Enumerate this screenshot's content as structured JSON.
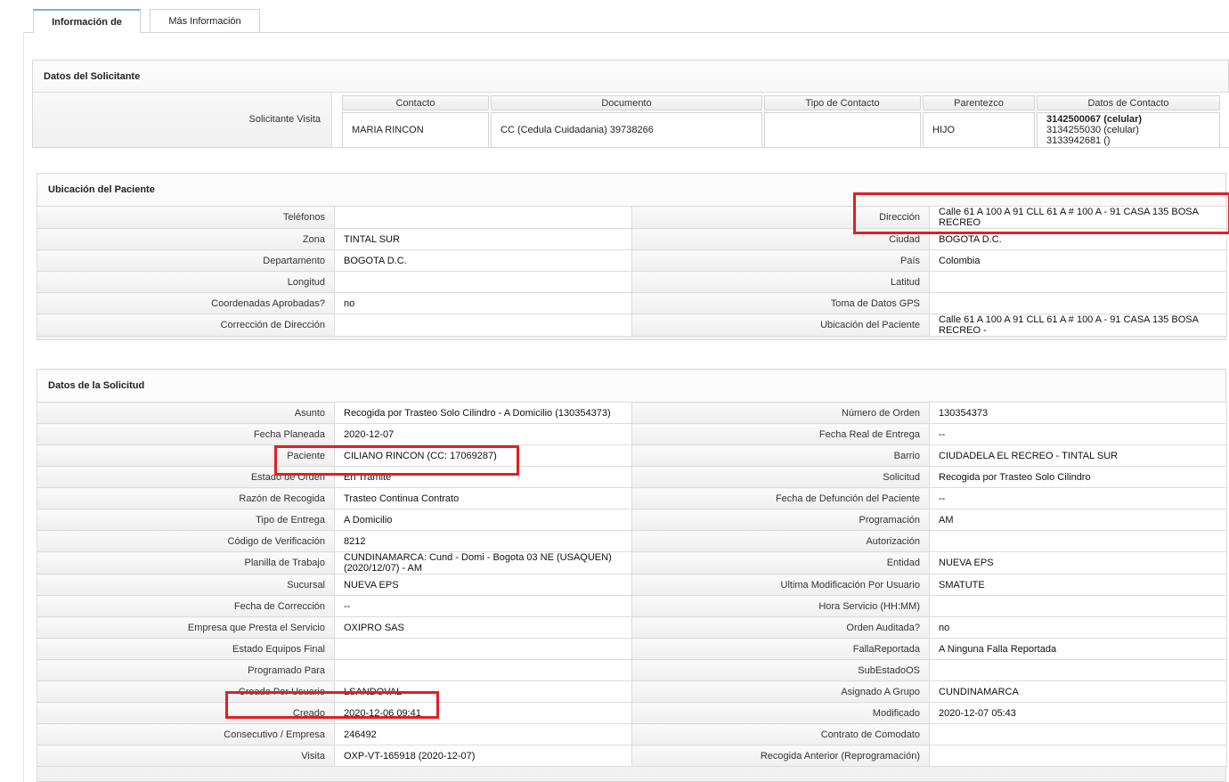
{
  "tabs": [
    {
      "label": "Información de",
      "active": true
    },
    {
      "label": "Más Información",
      "active": false
    }
  ],
  "solicitante": {
    "title": "Datos del Solicitante",
    "row_label": "Solicitante Visita",
    "headers": [
      "Contacto",
      "Documento",
      "Tipo de Contacto",
      "Parentezco",
      "Datos de Contacto"
    ],
    "contacto": "MARIA RINCON",
    "documento": "CC (Cedula Cuidadania) 39738266",
    "tipo_contacto": "",
    "parentezco": "HIJO",
    "datos_contacto": [
      "3142500067 (celular)",
      "3134255030 (celular)",
      "3133942681 ()"
    ]
  },
  "ubicacion": {
    "title": "Ubicación del Paciente",
    "rows": [
      {
        "l1": "Teléfonos",
        "v1": "",
        "l2": "Dirección",
        "v2": "Calle 61 A 100 A 91 CLL 61 A # 100 A - 91 CASA 135 BOSA RECREO"
      },
      {
        "l1": "Zona",
        "v1": "TINTAL SUR",
        "l2": "Ciudad",
        "v2": "BOGOTA D.C."
      },
      {
        "l1": "Departamento",
        "v1": "BOGOTA D.C.",
        "l2": "País",
        "v2": "Colombia"
      },
      {
        "l1": "Longitud",
        "v1": "",
        "l2": "Latitud",
        "v2": ""
      },
      {
        "l1": "Coordenadas Aprobadas?",
        "v1": "no",
        "l2": "Toma de Datos GPS",
        "v2": ""
      },
      {
        "l1": "Corrección de Dirección",
        "v1": "",
        "l2": "Ubicación del Paciente",
        "v2": "Calle 61 A 100 A 91 CLL 61 A # 100 A - 91 CASA 135 BOSA RECREO -"
      }
    ]
  },
  "solicitud": {
    "title": "Datos de la Solicitud",
    "rows": [
      {
        "l1": "Asunto",
        "v1": "Recogida por Trasteo Solo Cilindro - A Domicilio (130354373)",
        "l2": "Número de Orden",
        "v2": "130354373"
      },
      {
        "l1": "Fecha Planeada",
        "v1": "2020-12-07",
        "l2": "Fecha Real de Entrega",
        "v2": "--"
      },
      {
        "l1": "Paciente",
        "v1": "CILIANO RINCON (CC: 17069287)",
        "l2": "Barrio",
        "v2": "CIUDADELA EL RECREO - TINTAL SUR"
      },
      {
        "l1": "Estado de Orden",
        "v1": "En Tramite",
        "l2": "Solicitud",
        "v2": "Recogida por Trasteo Solo Cilindro"
      },
      {
        "l1": "Razón de Recogida",
        "v1": "Trasteo Continua Contrato",
        "l2": "Fecha de Defunción del Paciente",
        "v2": "--"
      },
      {
        "l1": "Tipo de Entrega",
        "v1": "A Domicilio",
        "l2": "Programación",
        "v2": "AM"
      },
      {
        "l1": "Código de Verificación",
        "v1": "8212",
        "l2": "Autorización",
        "v2": ""
      },
      {
        "l1": "Planilla de Trabajo",
        "v1": "CUNDINAMARCA: Cund - Domi - Bogota 03 NE (USAQUEN) (2020/12/07) - AM",
        "l2": "Entidad",
        "v2": "NUEVA EPS"
      },
      {
        "l1": "Sucursal",
        "v1": "NUEVA EPS",
        "l2": "Ultima Modificación Por Usuario",
        "v2": "SMATUTE"
      },
      {
        "l1": "Fecha de Corrección",
        "v1": "--",
        "l2": "Hora Servicio (HH:MM)",
        "v2": ""
      },
      {
        "l1": "Empresa que Presta el Servicio",
        "v1": "OXIPRO SAS",
        "l2": "Orden Auditada?",
        "v2": "no"
      },
      {
        "l1": "Estado Equipos Final",
        "v1": "",
        "l2": "FallaReportada",
        "v2": "A Ninguna Falla Reportada"
      },
      {
        "l1": "Programado Para",
        "v1": "",
        "l2": "SubEstadoOS",
        "v2": ""
      },
      {
        "l1": "Creado Por Usuario",
        "v1": "LSANDOVAL",
        "l2": "Asignado A Grupo",
        "v2": "CUNDINAMARCA"
      },
      {
        "l1": "Creado",
        "v1": "2020-12-06 09:41",
        "l2": "Modificado",
        "v2": "2020-12-07 05:43"
      },
      {
        "l1": "Consecutivo / Empresa",
        "v1": "246492",
        "l2": "Contrato de Comodato",
        "v2": ""
      },
      {
        "l1": "Visita",
        "v1": "OXP-VT-165918 (2020-12-07)",
        "l2": "Recogida Anterior (Reprogramación)",
        "v2": ""
      }
    ]
  },
  "highlight_color": "#e31e24"
}
